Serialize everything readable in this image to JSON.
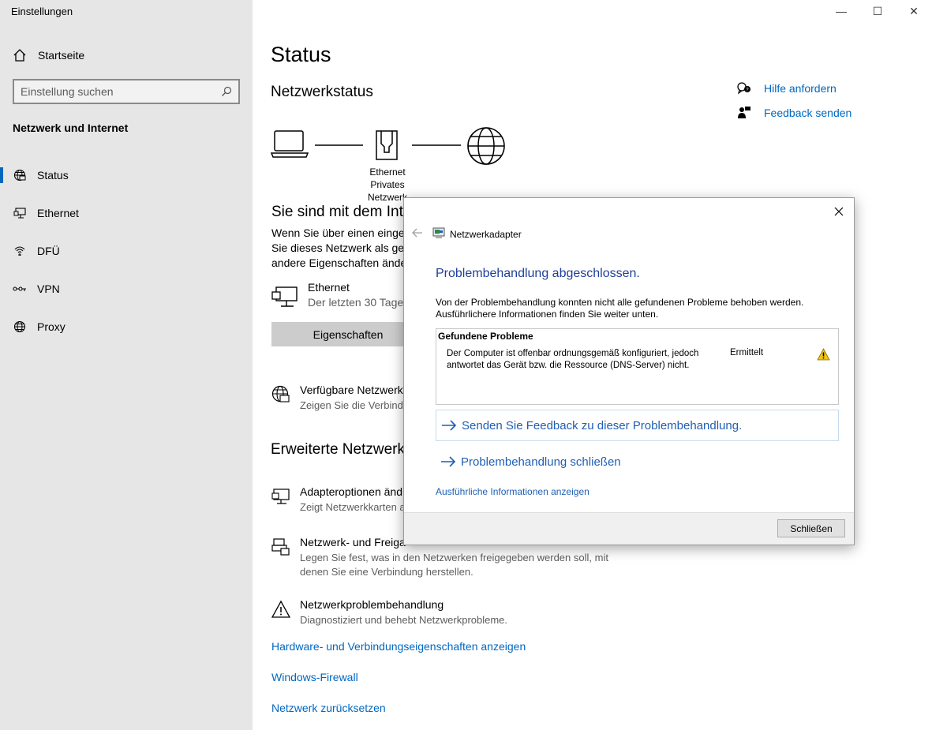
{
  "window": {
    "title": "Einstellungen",
    "minimize_label": "—",
    "maximize_label": "☐",
    "close_label": "✕"
  },
  "sidebar": {
    "home_label": "Startseite",
    "search_placeholder": "Einstellung suchen",
    "section_title": "Netzwerk und Internet",
    "items": [
      {
        "label": "Status",
        "icon": "globe-status-icon",
        "active": true
      },
      {
        "label": "Ethernet",
        "icon": "ethernet-icon"
      },
      {
        "label": "DFÜ",
        "icon": "dialup-icon"
      },
      {
        "label": "VPN",
        "icon": "vpn-icon"
      },
      {
        "label": "Proxy",
        "icon": "globe-icon"
      }
    ]
  },
  "main": {
    "title": "Status",
    "subtitle": "Netzwerkstatus",
    "help": {
      "label": "Hilfe anfordern",
      "icon": "help-chat-icon"
    },
    "feedback": {
      "label": "Feedback senden",
      "icon": "feedback-person-icon"
    },
    "diagram": {
      "line1": "Ethernet",
      "line2": "Privates Netzwerk"
    },
    "connected_title": "Sie sind mit dem Inte",
    "connected_text": [
      "Wenn Sie über einen einges",
      "Sie dieses Netzwerk als geta",
      "andere Eigenschaften ände"
    ],
    "ethernet": {
      "name": "Ethernet",
      "detail": "Der letzten 30 Tage"
    },
    "properties_button": "Eigenschaften",
    "available": {
      "title": "Verfügbare Netzwerke",
      "detail": "Zeigen Sie die Verbindu"
    },
    "advanced_title": "Erweiterte Netzwerk",
    "adapter": {
      "title": "Adapteroptionen änd",
      "detail": "Zeigt Netzwerkkarten a"
    },
    "sharing": {
      "title": "Netzwerk- und Freiga",
      "detail_line1": "Legen Sie fest, was in den Netzwerken freigegeben werden soll, mit",
      "detail_line2": "denen Sie eine Verbindung herstellen."
    },
    "troubleshoot": {
      "title": "Netzwerkproblembehandlung",
      "detail": "Diagnostiziert und behebt Netzwerkprobleme."
    },
    "links": [
      "Hardware- und Verbindungseigenschaften anzeigen",
      "Windows-Firewall",
      "Netzwerk zurücksetzen"
    ]
  },
  "dialog": {
    "close_label": "✕",
    "header": "Netzwerkadapter",
    "title": "Problembehandlung abgeschlossen.",
    "description_line1": "Von der Problembehandlung konnten nicht alle gefundenen Probleme behoben werden.",
    "description_line2": "Ausführlichere Informationen finden Sie weiter unten.",
    "problems_header": "Gefundene Probleme",
    "problem_desc_line1": "Der Computer ist offenbar ordnungsgemäß konfiguriert, jedoch",
    "problem_desc_line2": "antwortet das Gerät bzw. die Ressource (DNS-Server) nicht.",
    "problem_status": "Ermittelt",
    "feedback_link": "Senden Sie Feedback zu dieser Problembehandlung.",
    "close_link": "Problembehandlung schließen",
    "more_info_link": "Ausführliche Informationen anzeigen",
    "close_button": "Schließen"
  },
  "colors": {
    "accent": "#0067c0",
    "dialog_link": "#1f5fb3",
    "warning": "#f2c511"
  }
}
